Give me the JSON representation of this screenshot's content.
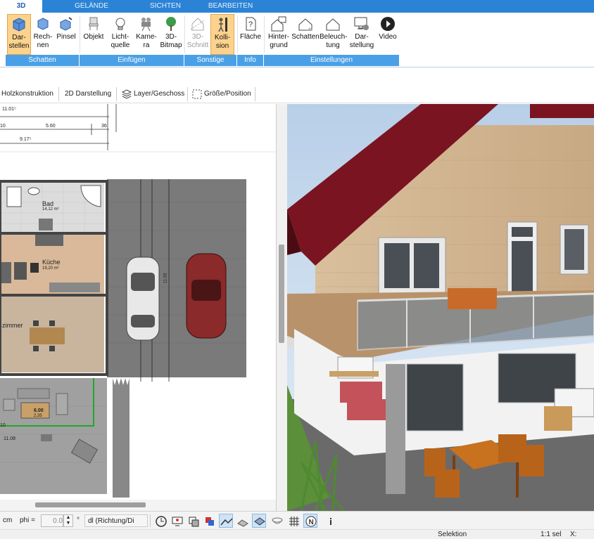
{
  "tabs": {
    "t3d": "3D",
    "gelaende": "GELÄNDE",
    "sichten": "SICHTEN",
    "bearbeiten": "BEARBEITEN"
  },
  "ribbon": {
    "darstellen": "Dar-\nstellen",
    "rechnen": "Rech-\nnen",
    "pinsel": "Pinsel",
    "objekt": "Objekt",
    "lichtquelle": "Licht-\nquelle",
    "kamera": "Kame-\nra",
    "bitmap": "3D-\nBitmap",
    "schnitt": "3D-\nSchnitt",
    "kollision": "Kolli-\nsion",
    "flaeche": "Fläche",
    "hintergrund": "Hinter-\ngrund",
    "schatten": "Schatten",
    "beleuchtung": "Beleuch-\ntung",
    "darstellung": "Dar-\nstellung",
    "video": "Video"
  },
  "groups": {
    "schatten": "Schatten",
    "einfuegen": "Einfügen",
    "sonstige": "Sonstige",
    "info": "Info",
    "einstellungen": "Einstellungen"
  },
  "toolbar2": {
    "holz": "Holzkonstruktion",
    "zweid": "2D Darstellung",
    "layer": "Layer/Geschoss",
    "groesse": "Größe/Position"
  },
  "plan": {
    "dim_top": "11.01⁵",
    "dim_10": "10",
    "dim_560": "5.60",
    "dim_36": "36",
    "dim_917": "9.17⁵",
    "bad": "Bad",
    "bad_area": "14,12 m²",
    "kueche": "Küche",
    "kueche_area": "19,20 m²",
    "zimmer": "zimmer",
    "dim_600": "6.00",
    "dim_235": "2.35",
    "dim_1108": "11.08",
    "dim_10b": "10",
    "dim_1103": "11.03"
  },
  "bottom": {
    "cm": "cm",
    "phi": "phi =",
    "phi_value": "0.0",
    "deg": "°",
    "dl": "dl (Richtung/Di"
  },
  "status": {
    "selektion": "Selektion",
    "sel": "1:1 sel",
    "x": "X:"
  },
  "colors": {
    "tab_bar": "#2b83d6",
    "group_bar": "#4aa0e6",
    "active_btn": "#fbd38d",
    "kitchen": "#d9b99a",
    "living": "#c9b59e",
    "paving": "#777777",
    "roof": "#7a1420",
    "sky": "#cfe0f2",
    "grass": "#7fb84a"
  }
}
